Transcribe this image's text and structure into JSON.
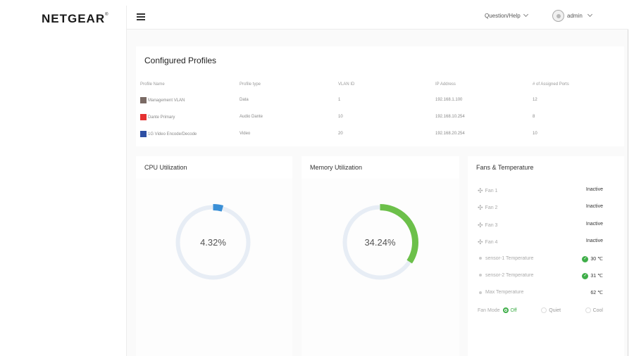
{
  "brand": {
    "logo": "NETGEAR",
    "mark": "®"
  },
  "header": {
    "help_label": "Question/Help",
    "user_label": "admin"
  },
  "profiles": {
    "title": "Configured Profiles",
    "columns": [
      "Profile Name",
      "Profile type",
      "VLAN ID",
      "IP Address",
      "# of Assigned Ports"
    ],
    "rows": [
      {
        "color": "#7a6a64",
        "name": "Management VLAN",
        "type": "Data",
        "vlan": "1",
        "ip": "192.168.1.100",
        "ports": "12"
      },
      {
        "color": "#e53131",
        "name": "Dante Primary",
        "type": "Audio Dante",
        "vlan": "10",
        "ip": "192.168.10.254",
        "ports": "8"
      },
      {
        "color": "#2e4fa3",
        "name": "1G Video Encode/Decode",
        "type": "Video",
        "vlan": "20",
        "ip": "192.168.20.254",
        "ports": "10"
      }
    ]
  },
  "cpu": {
    "title": "CPU Utilization",
    "value_text": "4.32%",
    "percent": 4.32,
    "color": "#3a8fd6",
    "track": "#e7edf5"
  },
  "memory": {
    "title": "Memory Utilization",
    "value_text": "34.24%",
    "percent": 34.24,
    "color": "#6cc04a",
    "track": "#e7edf5"
  },
  "fans": {
    "title": "Fans & Temperature",
    "items": [
      {
        "icon": "fan-icon",
        "name": "Fan 1",
        "value": "Inactive",
        "ok": false
      },
      {
        "icon": "fan-icon",
        "name": "Fan 2",
        "value": "Inactive",
        "ok": false
      },
      {
        "icon": "fan-icon",
        "name": "Fan 3",
        "value": "Inactive",
        "ok": false
      },
      {
        "icon": "fan-icon",
        "name": "Fan 4",
        "value": "Inactive",
        "ok": false
      },
      {
        "icon": "sensor-icon",
        "name": "sensor-1 Temperature",
        "value": "30 ℃",
        "ok": true
      },
      {
        "icon": "sensor-icon",
        "name": "sensor-2 Temperature",
        "value": "31 ℃",
        "ok": true
      },
      {
        "icon": "sensor-icon",
        "name": "Max Temperature",
        "value": "62 ℃",
        "ok": false
      }
    ],
    "mode_label": "Fan Mode",
    "modes": [
      {
        "label": "Off",
        "selected": true
      },
      {
        "label": "Quiet",
        "selected": false
      },
      {
        "label": "Cool",
        "selected": false
      }
    ]
  }
}
